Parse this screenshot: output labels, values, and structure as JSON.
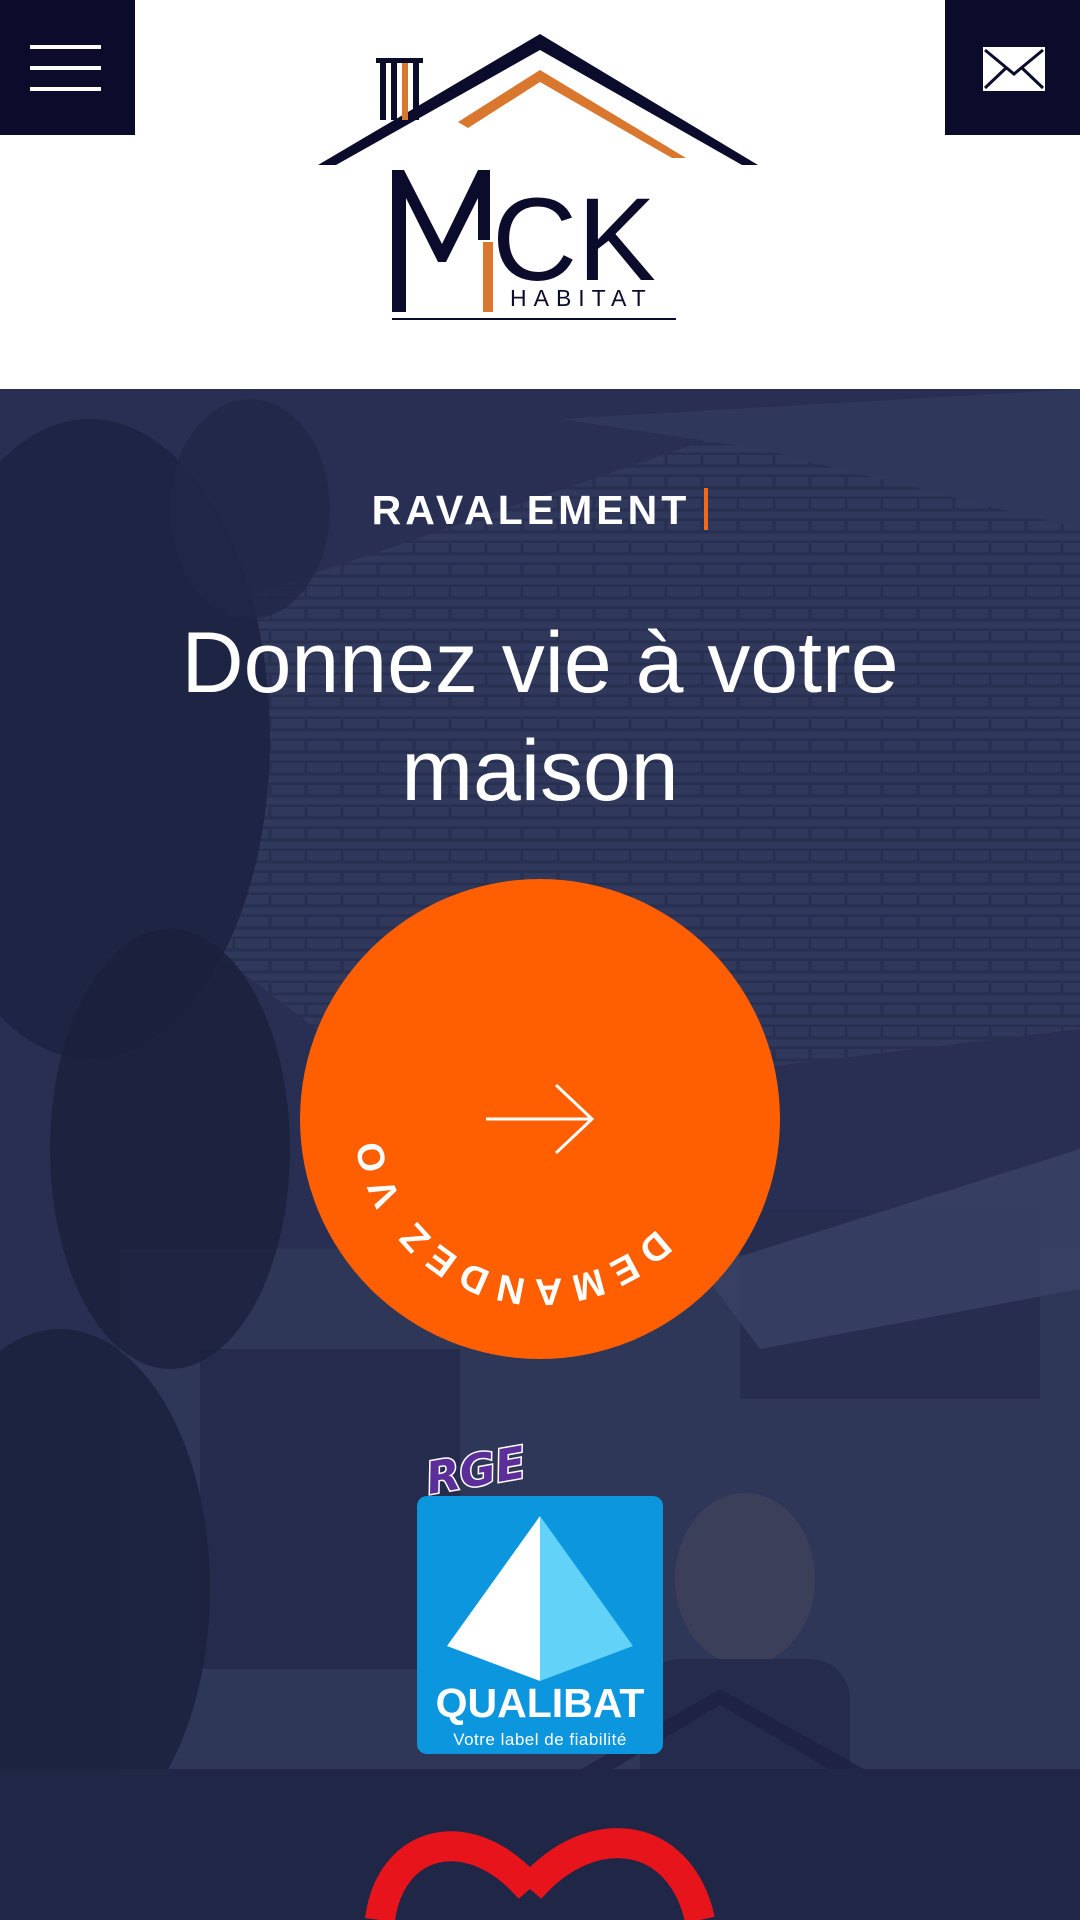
{
  "header": {
    "menu_icon": "hamburger-menu-icon",
    "mail_icon": "envelope-icon",
    "logo": {
      "wordmark": "MCK",
      "subtitle": "HABITAT"
    }
  },
  "hero": {
    "kicker": "RAVALEMENT",
    "headline": "Donnez vie à votre maison",
    "cta": {
      "circular_text": "DEMANDEZ VOTRE DEVIS",
      "icon": "arrow-right-icon"
    }
  },
  "certification": {
    "rge_label": "RGE",
    "brand": "QUALIBAT",
    "tagline": "Votre label de fiabilité"
  },
  "colors": {
    "navy": "#0b0b2c",
    "orange": "#ff5f00",
    "logo_orange": "#d9772f",
    "qualibat_blue": "#0b96de",
    "rge_purple": "#5b2e99",
    "red_arc": "#e8141c"
  }
}
